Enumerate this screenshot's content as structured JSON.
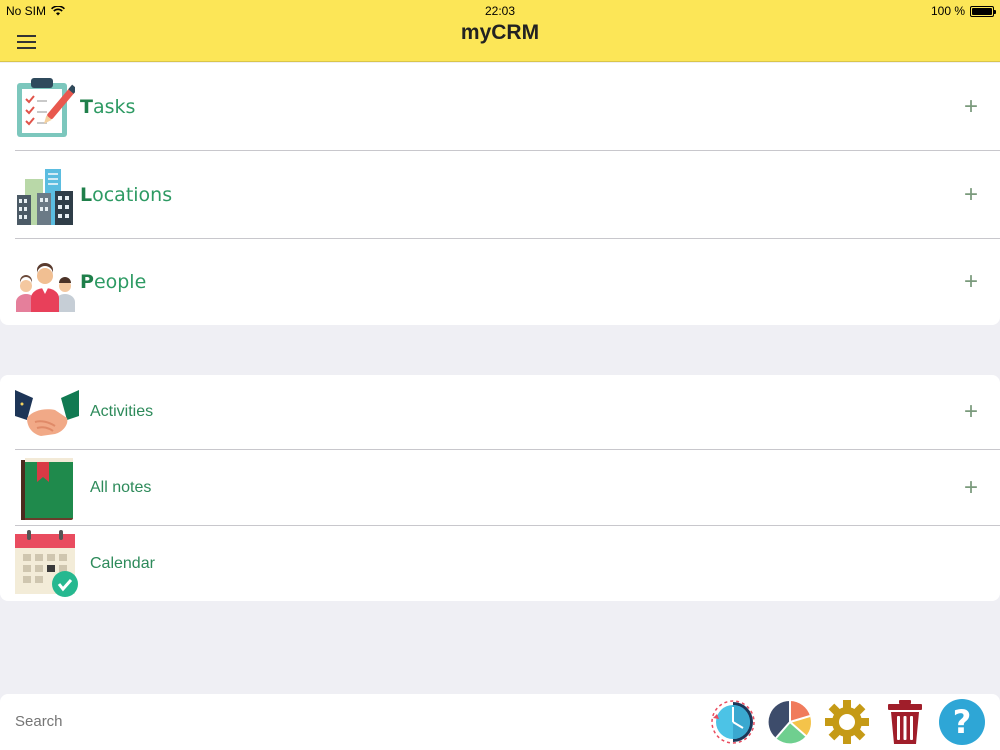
{
  "status_bar": {
    "carrier": "No SIM",
    "time": "22:03",
    "battery": "100 %"
  },
  "nav": {
    "title": "myCRM",
    "menu_icon": "hamburger-menu-icon"
  },
  "main_group": [
    {
      "first_letter": "T",
      "rest": "asks",
      "icon": "clipboard-tasks-icon",
      "has_add": true
    },
    {
      "first_letter": "L",
      "rest": "ocations",
      "icon": "buildings-icon",
      "has_add": true
    },
    {
      "first_letter": "P",
      "rest": "eople",
      "icon": "people-icon",
      "has_add": true
    }
  ],
  "secondary_group": [
    {
      "label": "Activities",
      "icon": "handshake-icon",
      "has_add": true
    },
    {
      "label": "All notes",
      "icon": "notebook-icon",
      "has_add": true
    },
    {
      "label": "Calendar",
      "icon": "calendar-check-icon",
      "has_add": false
    }
  ],
  "add_symbol": "+",
  "search": {
    "placeholder": "Search",
    "value": ""
  },
  "toolbar": [
    {
      "name": "history-clock-icon"
    },
    {
      "name": "pie-chart-icon"
    },
    {
      "name": "settings-gear-icon"
    },
    {
      "name": "trash-icon"
    },
    {
      "name": "help-icon"
    }
  ],
  "colors": {
    "nav_bg": "#fce657",
    "label_green": "#2d9a63",
    "background": "#efeff4"
  }
}
